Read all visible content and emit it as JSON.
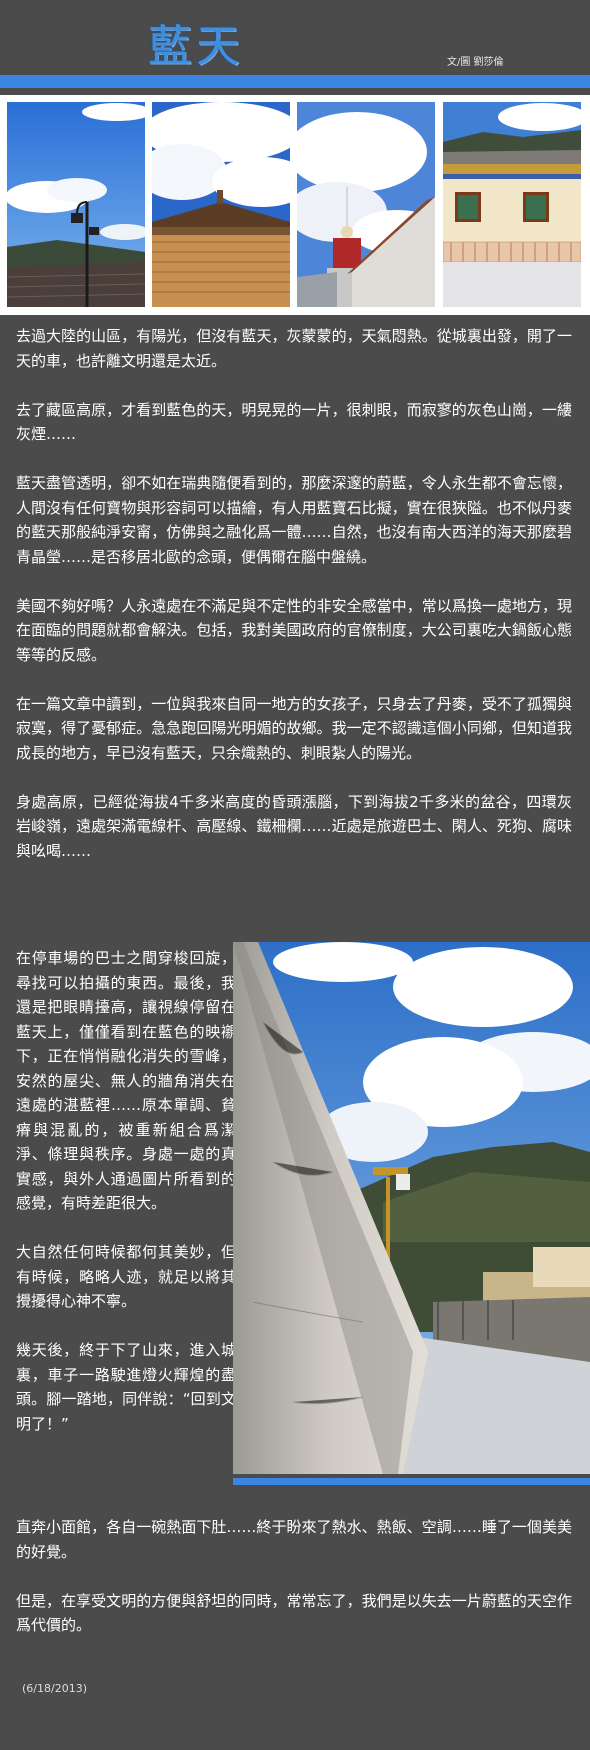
{
  "header": {
    "title": "藍天",
    "byline": "文/圖 劉莎倫"
  },
  "colors": {
    "background": "#4b4b4b",
    "accent_blue": "#3a86e2",
    "title_blue": "#3d8fe0"
  },
  "paragraphs_top": [
    "去過大陸的山區，有陽光，但沒有藍天，灰蒙蒙的，天氣悶熱。從城裏出發，開了一天的車，也許離文明還是太近。",
    "去了藏區高原，才看到藍色的天，明晃晃的一片，很刺眼，而寂寥的灰色山崗，一縷灰煙……",
    "藍天盡管透明，卻不如在瑞典隨便看到的，那麼深邃的蔚藍，令人永生都不會忘懷，人間沒有任何寶物與形容詞可以描繪，有人用藍寶石比擬，實在很狹隘。也不似丹麥的藍天那般純淨安甯，仿佛與之融化爲一體……自然，也沒有南大西洋的海天那麼碧青晶瑩……是否移居北歐的念頭，便偶爾在腦中盤繞。",
    "美國不夠好嗎？人永遠處在不滿足與不定性的非安全感當中，常以爲換一處地方，現在面臨的問題就都會解決。包括，我對美國政府的官僚制度，大公司裏吃大鍋飯心態等等的反感。",
    "在一篇文章中讀到，一位與我來自同一地方的女孩子，只身去了丹麥，受不了孤獨與寂寞，得了憂郁症。急急跑回陽光明媚的故鄉。我一定不認識這個小同鄉，但知道我成長的地方，早已沒有藍天，只余熾熱的、刺眼紮人的陽光。",
    "身處高原，已經從海拔4千多米高度的昏頭漲腦，下到海拔2千多米的盆谷，四環灰岩峻嶺，遠處架滿電線杆、高壓線、鐵柵欄……近處是旅遊巴士、閑人、死狗、腐味與吆喝……"
  ],
  "paragraphs_float": [
    "在停車場的巴士之間穿梭回旋，尋找可以拍攝的東西。最後，我還是把眼睛擡高，讓視線停留在藍天上，僅僅看到在藍色的映襯下，正在悄悄融化消失的雪峰，安然的屋尖、無人的牆角消失在遠處的湛藍裡……原本單調、貧瘠與混亂的，被重新組合爲潔淨、條理與秩序。身處一處的真實感，與外人通過圖片所看到的感覺，有時差距很大。",
    "大自然任何時候都何其美妙，但有時候，略略人迹，就足以將其攪擾得心神不寧。",
    "幾天後，終于下了山來，進入城裏，車子一路駛進燈火輝煌的盡頭。腳一踏地，同伴說：“回到文明了！”"
  ],
  "paragraphs_bottom": [
    "直奔小面館，各自一碗熱面下肚……終于盼來了熱水、熱飯、空調……睡了一個美美的好覺。",
    "但是，在享受文明的方便與舒坦的同時，常常忘了，我們是以失去一片蔚藍的天空作爲代價的。"
  ],
  "date": "(6/18/2013)"
}
